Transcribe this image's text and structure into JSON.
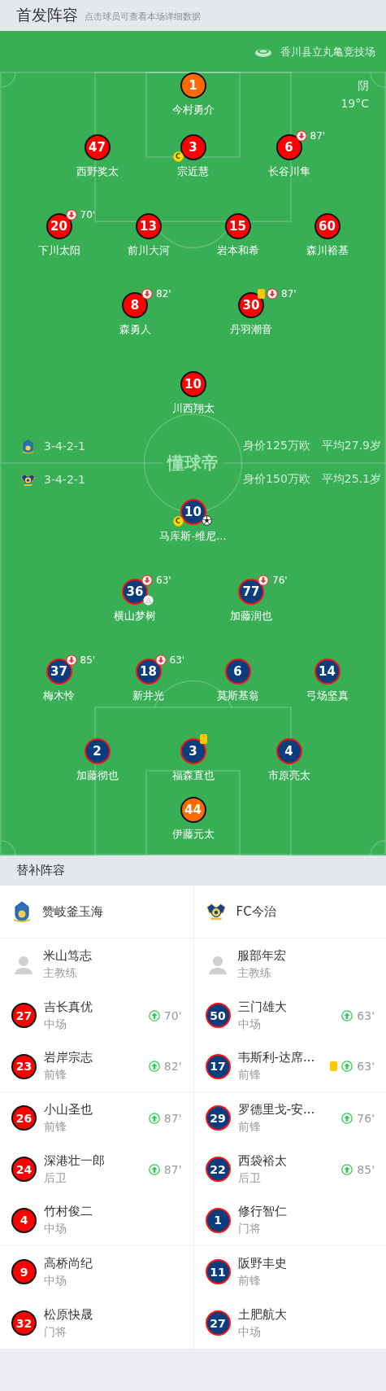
{
  "header": {
    "title": "首发阵容",
    "hint": "点击球员可查看本场详细数据"
  },
  "venue": {
    "name": "香川县立丸亀竞技场"
  },
  "weather": {
    "condition": "阴",
    "temperature": "19°C"
  },
  "pitch_logo": "懂球帝",
  "lineup": {
    "teams": [
      {
        "color": "#ff0000",
        "formation": "3-4-2-1",
        "market_value": "身价125万欧",
        "average_age": "平均27.9岁",
        "rows": [
          [
            {
              "number": "1",
              "name": "今村勇介",
              "kind": "goalkeeper"
            }
          ],
          [
            {
              "number": "47",
              "name": "西野奖太",
              "kind": "outfield"
            },
            {
              "number": "3",
              "name": "宗近慧",
              "kind": "outfield",
              "events": [
                {
                  "kind": "captain",
                  "label": "C"
                }
              ]
            },
            {
              "number": "6",
              "name": "长谷川隼",
              "kind": "outfield",
              "events": [
                {
                  "kind": "sub_off",
                  "minute": "87'"
                }
              ]
            }
          ],
          [
            {
              "number": "20",
              "name": "下川太阳",
              "kind": "outfield",
              "events": [
                {
                  "kind": "sub_off",
                  "minute": "70'"
                }
              ]
            },
            {
              "number": "13",
              "name": "前川大河",
              "kind": "outfield"
            },
            {
              "number": "15",
              "name": "岩本和希",
              "kind": "outfield"
            },
            {
              "number": "60",
              "name": "森川裕基",
              "kind": "outfield"
            }
          ],
          [
            {
              "number": "8",
              "name": "森勇人",
              "kind": "outfield",
              "events": [
                {
                  "kind": "sub_off",
                  "minute": "82'"
                }
              ]
            },
            {
              "number": "30",
              "name": "丹羽潮音",
              "kind": "outfield",
              "events": [
                {
                  "kind": "yellow_card"
                },
                {
                  "kind": "sub_off",
                  "minute": "87'"
                }
              ]
            }
          ],
          [
            {
              "number": "10",
              "name": "川西翔太",
              "kind": "outfield"
            }
          ]
        ]
      },
      {
        "color": "#0a3d7d",
        "formation": "3-4-2-1",
        "market_value": "身价150万欧",
        "average_age": "平均25.1岁",
        "rows": [
          [
            {
              "number": "10",
              "name": "马库斯-维尼...",
              "kind": "outfield",
              "events": [
                {
                  "kind": "captain",
                  "label": "C"
                },
                {
                  "kind": "goal"
                }
              ]
            }
          ],
          [
            {
              "number": "36",
              "name": "横山梦树",
              "kind": "outfield",
              "events": [
                {
                  "kind": "sub_off",
                  "minute": "63'"
                },
                {
                  "kind": "assist"
                }
              ]
            },
            {
              "number": "77",
              "name": "加藤润也",
              "kind": "outfield",
              "events": [
                {
                  "kind": "sub_off",
                  "minute": "76'"
                }
              ]
            }
          ],
          [
            {
              "number": "37",
              "name": "梅木怜",
              "kind": "outfield",
              "events": [
                {
                  "kind": "sub_off",
                  "minute": "85'"
                }
              ]
            },
            {
              "number": "18",
              "name": "新井光",
              "kind": "outfield",
              "events": [
                {
                  "kind": "sub_off",
                  "minute": "63'"
                }
              ]
            },
            {
              "number": "6",
              "name": "莫斯基翁",
              "kind": "outfield"
            },
            {
              "number": "14",
              "name": "弓场坚真",
              "kind": "outfield"
            }
          ],
          [
            {
              "number": "2",
              "name": "加藤彻也",
              "kind": "outfield"
            },
            {
              "number": "3",
              "name": "福森直也",
              "kind": "outfield",
              "events": [
                {
                  "kind": "yellow_card"
                }
              ]
            },
            {
              "number": "4",
              "name": "市原亮太",
              "kind": "outfield"
            }
          ],
          [
            {
              "number": "44",
              "name": "伊藤元太",
              "kind": "goalkeeper"
            }
          ]
        ]
      }
    ]
  },
  "substitutes": {
    "title": "替补阵容",
    "teams": [
      {
        "name": "赞岐釜玉海",
        "color": "#ff0000",
        "coach": {
          "name": "米山笃志",
          "role": "主教练"
        },
        "players": [
          {
            "number": "27",
            "name": "吉长真优",
            "position": "中场",
            "events": [
              {
                "kind": "sub_on",
                "minute": "70'"
              }
            ]
          },
          {
            "number": "23",
            "name": "岩岸宗志",
            "position": "前锋",
            "events": [
              {
                "kind": "sub_on",
                "minute": "82'"
              }
            ]
          },
          {
            "number": "26",
            "name": "小山圣也",
            "position": "前锋",
            "events": [
              {
                "kind": "sub_on",
                "minute": "87'"
              }
            ]
          },
          {
            "number": "24",
            "name": "深港壮一郎",
            "position": "后卫",
            "events": [
              {
                "kind": "sub_on",
                "minute": "87'"
              }
            ]
          },
          {
            "number": "4",
            "name": "竹村俊二",
            "position": "中场"
          },
          {
            "number": "9",
            "name": "高桥尚纪",
            "position": "中场"
          },
          {
            "number": "32",
            "name": "松原快晟",
            "position": "门将"
          }
        ]
      },
      {
        "name": "FC今治",
        "color": "#0a3d7d",
        "coach": {
          "name": "服部年宏",
          "role": "主教练"
        },
        "players": [
          {
            "number": "50",
            "name": "三门雄大",
            "position": "中场",
            "events": [
              {
                "kind": "sub_on",
                "minute": "63'"
              }
            ]
          },
          {
            "number": "17",
            "name": "韦斯利-达席...",
            "position": "前锋",
            "events": [
              {
                "kind": "yellow_card"
              },
              {
                "kind": "sub_on",
                "minute": "63'"
              }
            ]
          },
          {
            "number": "29",
            "name": "罗德里戈-安...",
            "position": "前锋",
            "events": [
              {
                "kind": "sub_on",
                "minute": "76'"
              }
            ]
          },
          {
            "number": "22",
            "name": "西袋裕太",
            "position": "后卫",
            "events": [
              {
                "kind": "sub_on",
                "minute": "85'"
              }
            ]
          },
          {
            "number": "1",
            "name": "修行智仁",
            "position": "门将"
          },
          {
            "number": "11",
            "name": "阪野丰史",
            "position": "前锋"
          },
          {
            "number": "27",
            "name": "土肥航大",
            "position": "中场"
          }
        ]
      }
    ]
  }
}
